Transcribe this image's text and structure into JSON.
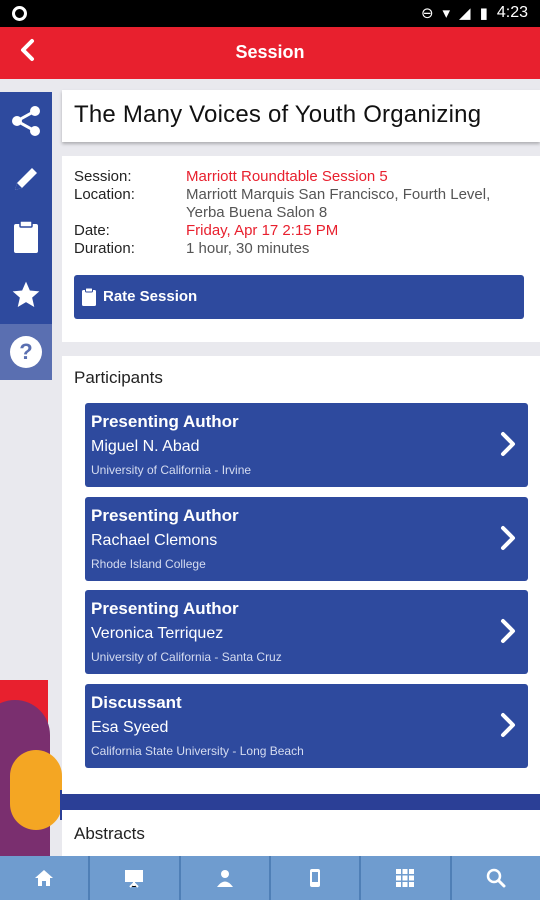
{
  "status_bar": {
    "time": "4:23"
  },
  "app_bar": {
    "title": "Session",
    "back_icon": "chevron-left-icon"
  },
  "sidebar": {
    "items": [
      {
        "icon": "share-icon"
      },
      {
        "icon": "pencil-icon"
      },
      {
        "icon": "clipboard-icon"
      },
      {
        "icon": "star-icon"
      },
      {
        "icon": "help-icon"
      }
    ]
  },
  "session": {
    "title": "The Many Voices of Youth Organizing",
    "labels": {
      "session": "Session:",
      "location": "Location:",
      "date": "Date:",
      "duration": "Duration:"
    },
    "session_name": "Marriott Roundtable Session 5",
    "location_line1": "Marriott Marquis San Francisco, Fourth Level,",
    "location_line2": "Yerba Buena Salon 8",
    "date": "Friday, Apr 17 2:15 PM",
    "duration": "1 hour, 30 minutes",
    "rate_label": "Rate Session"
  },
  "participants": {
    "header": "Participants",
    "items": [
      {
        "role": "Presenting Author",
        "name": "Miguel N. Abad",
        "institution": "University of California - Irvine"
      },
      {
        "role": "Presenting Author",
        "name": "Rachael Clemons",
        "institution": "Rhode Island College"
      },
      {
        "role": "Presenting Author",
        "name": "Veronica Terriquez",
        "institution": "University of California - Santa Cruz"
      },
      {
        "role": "Discussant",
        "name": "Esa Syeed",
        "institution": "California State University - Long Beach"
      }
    ]
  },
  "abstracts": {
    "header": "Abstracts"
  },
  "bottom_nav": {
    "items": [
      {
        "icon": "home-icon"
      },
      {
        "icon": "presentation-icon"
      },
      {
        "icon": "person-icon"
      },
      {
        "icon": "phone-icon"
      },
      {
        "icon": "grid-icon"
      },
      {
        "icon": "search-icon"
      }
    ]
  },
  "colors": {
    "accent_red": "#e8202e",
    "brand_blue": "#2e4a9e",
    "nav_blue": "#6f9ccf"
  }
}
